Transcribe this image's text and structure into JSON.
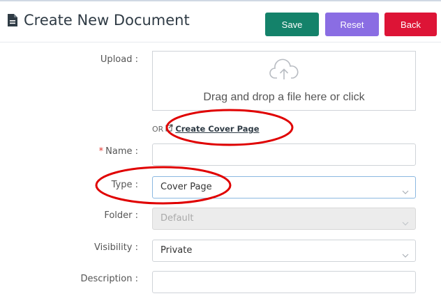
{
  "header": {
    "title": "Create New Document",
    "save_label": "Save",
    "reset_label": "Reset",
    "back_label": "Back"
  },
  "colors": {
    "save": "#14826a",
    "reset": "#8a6de3",
    "back": "#dd1436",
    "annotation": "#e00000"
  },
  "form": {
    "upload": {
      "label": "Upload :",
      "drop_text": "Drag and drop a file here or click"
    },
    "alt_action": {
      "or_text": "OR",
      "link_label": "Create Cover Page"
    },
    "name": {
      "required_mark": "*",
      "label": "Name :",
      "value": ""
    },
    "type": {
      "label": "Type :",
      "value": "Cover Page"
    },
    "folder": {
      "label": "Folder :",
      "value": "Default"
    },
    "visibility": {
      "label": "Visibility :",
      "value": "Private"
    },
    "description": {
      "label": "Description :",
      "value": ""
    }
  },
  "icons": [
    "document-icon",
    "cloud-upload-icon",
    "external-link-icon",
    "chevron-down-icon"
  ]
}
